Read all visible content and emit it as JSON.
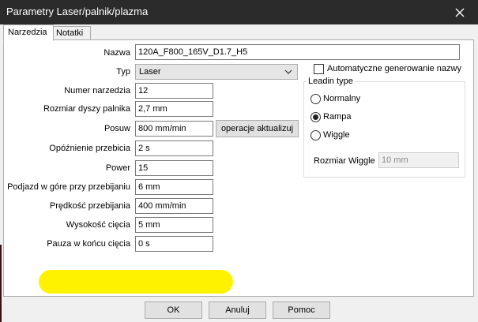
{
  "window": {
    "title": "Parametry Laser/palnik/plazma"
  },
  "tabs": [
    {
      "label": "Narzedzia"
    },
    {
      "label": "Notatki"
    }
  ],
  "form": {
    "nazwa": {
      "label": "Nazwa",
      "value": "120A_F800_165V_D1.7_H5"
    },
    "typ": {
      "label": "Typ",
      "value": "Laser"
    },
    "numer": {
      "label": "Numer narzedzia",
      "value": "12"
    },
    "dysza": {
      "label": "Rozmiar dyszy palnika",
      "value": "2,7 mm"
    },
    "posuw": {
      "label": "Posuw",
      "value": "800 mm/min"
    },
    "opoznienie": {
      "label": "Opóźnienie przebicia",
      "value": "2 s"
    },
    "power": {
      "label": "Power",
      "value": "15"
    },
    "podjazd": {
      "label": "Podjazd w góre przy przebijaniu",
      "value": "6 mm"
    },
    "predkosc": {
      "label": "Prędkość przebijania",
      "value": "400 mm/min"
    },
    "wysokosc": {
      "label": "Wysokość cięcia",
      "value": "5 mm"
    },
    "pauza": {
      "label": "Pauza w końcu cięcia",
      "value": "0 s"
    }
  },
  "update_button": "operacje aktualizuj",
  "auto_name": {
    "label": "Automatyczne generowanie nazwy",
    "checked": false
  },
  "leadin": {
    "title": "Leadin type",
    "options": [
      {
        "label": "Normalny",
        "checked": false
      },
      {
        "label": "Rampa",
        "checked": true
      },
      {
        "label": "Wiggle",
        "checked": false
      }
    ],
    "wiggle_size": {
      "label": "Rozmiar Wiggle",
      "value": "10 mm"
    }
  },
  "buttons": {
    "ok": "OK",
    "cancel": "Anuluj",
    "help": "Pomoc"
  },
  "colors": {
    "highlight": "#fff200",
    "titlebar": "#2b2b2b"
  }
}
